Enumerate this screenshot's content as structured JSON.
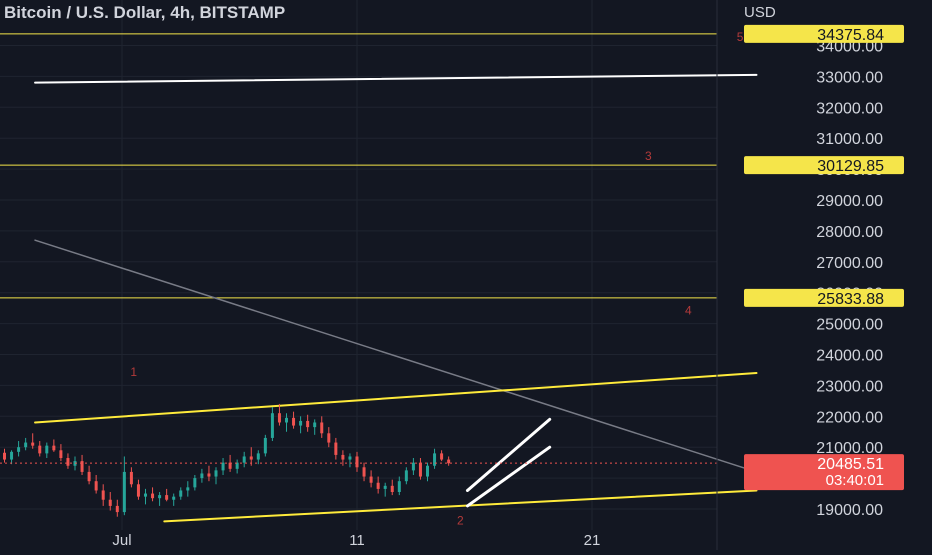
{
  "header": {
    "title": "Bitcoin / U.S. Dollar, 4h, BITSTAMP"
  },
  "axis": {
    "currency": "USD"
  },
  "colors": {
    "background": "#131722",
    "grid": "#1f2430",
    "up": "#26a69a",
    "down": "#ef5350",
    "level": "#f5e54a",
    "channel": "#ffeb3b",
    "white_line": "#ffffff",
    "trend": "#787b86",
    "wave_label": "#b33a3a",
    "axis_text": "#d1d4dc"
  },
  "chart_data": {
    "type": "candlestick",
    "title": "Bitcoin / U.S. Dollar, 4h, BITSTAMP",
    "ylabel": "USD",
    "ylim": [
      18350,
      35000
    ],
    "xlabel": "",
    "x_ticks": [
      "Jul",
      "11",
      "21"
    ],
    "y_ticks": [
      19000,
      20000,
      21000,
      22000,
      23000,
      24000,
      25000,
      26000,
      27000,
      28000,
      29000,
      30000,
      31000,
      32000,
      33000,
      34000
    ],
    "y_tick_labels": [
      "19000.00",
      "20000.00",
      "21000.00",
      "22000.00",
      "23000.00",
      "24000.00",
      "25000.00",
      "26000.00",
      "27000.00",
      "28000.00",
      "29000.00",
      "30000.00",
      "31000.00",
      "32000.00",
      "33000.00",
      "34000.00"
    ],
    "last_price": {
      "value": 20485.51,
      "label": "20485.51",
      "countdown": "03:40:01"
    },
    "horizontal_levels": [
      {
        "value": 34375.84,
        "label": "34375.84"
      },
      {
        "value": 30129.85,
        "label": "30129.85"
      },
      {
        "value": 25833.88,
        "label": "25833.88"
      }
    ],
    "wave_labels": [
      {
        "text": "1",
        "day": 0.5,
        "price": 23300
      },
      {
        "text": "2",
        "day": 14.4,
        "price": 18500
      },
      {
        "text": "3",
        "day": 22.4,
        "price": 30300
      },
      {
        "text": "4",
        "day": 24.1,
        "price": 25300
      },
      {
        "text": "5",
        "day": 26.3,
        "price": 34150
      }
    ],
    "lines": [
      {
        "role": "white-resistance",
        "from": {
          "day": -3.7,
          "price": 32800
        },
        "to": {
          "day": 27,
          "price": 33050
        }
      },
      {
        "role": "descending-trend",
        "from": {
          "day": -3.7,
          "price": 27700
        },
        "to": {
          "day": 27,
          "price": 20200
        }
      },
      {
        "role": "channel-top",
        "from": {
          "day": -3.7,
          "price": 21800
        },
        "to": {
          "day": 27,
          "price": 23400
        }
      },
      {
        "role": "channel-bottom",
        "from": {
          "day": 1.8,
          "price": 18600
        },
        "to": {
          "day": 27,
          "price": 19600
        }
      },
      {
        "role": "rising-channel-upper",
        "from": {
          "day": 14.7,
          "price": 19600
        },
        "to": {
          "day": 18.2,
          "price": 21900
        }
      },
      {
        "role": "rising-channel-lower",
        "from": {
          "day": 14.7,
          "price": 19100
        },
        "to": {
          "day": 18.2,
          "price": 21000
        }
      }
    ],
    "candles": [
      [
        20750,
        21050,
        20600,
        20820
      ],
      [
        20820,
        20950,
        20500,
        20600
      ],
      [
        20600,
        20900,
        20450,
        20850
      ],
      [
        20850,
        21200,
        20700,
        21000
      ],
      [
        21000,
        21300,
        20900,
        21150
      ],
      [
        21150,
        21450,
        20950,
        21050
      ],
      [
        21050,
        21200,
        20700,
        20800
      ],
      [
        20800,
        21150,
        20650,
        21050
      ],
      [
        21050,
        21250,
        20850,
        20900
      ],
      [
        20900,
        21100,
        20550,
        20650
      ],
      [
        20650,
        20800,
        20300,
        20400
      ],
      [
        20400,
        20700,
        20250,
        20550
      ],
      [
        20550,
        20750,
        20100,
        20200
      ],
      [
        20200,
        20400,
        19800,
        19900
      ],
      [
        19900,
        20100,
        19500,
        19600
      ],
      [
        19600,
        19800,
        19100,
        19300
      ],
      [
        19300,
        19550,
        18950,
        19100
      ],
      [
        19100,
        19300,
        18750,
        18900
      ],
      [
        18900,
        20700,
        18800,
        20200
      ],
      [
        20200,
        20350,
        19700,
        19800
      ],
      [
        19800,
        19950,
        19300,
        19400
      ],
      [
        19400,
        19650,
        19150,
        19500
      ],
      [
        19500,
        19700,
        19250,
        19350
      ],
      [
        19350,
        19550,
        19100,
        19450
      ],
      [
        19450,
        19650,
        19250,
        19300
      ],
      [
        19300,
        19500,
        19100,
        19400
      ],
      [
        19400,
        19700,
        19300,
        19600
      ],
      [
        19600,
        19900,
        19400,
        19700
      ],
      [
        19700,
        20100,
        19600,
        20000
      ],
      [
        20000,
        20300,
        19850,
        20150
      ],
      [
        20150,
        20400,
        19900,
        20050
      ],
      [
        20050,
        20350,
        19800,
        20250
      ],
      [
        20250,
        20650,
        20100,
        20500
      ],
      [
        20500,
        20750,
        20200,
        20300
      ],
      [
        20300,
        20600,
        20150,
        20500
      ],
      [
        20500,
        20850,
        20350,
        20700
      ],
      [
        20700,
        21000,
        20400,
        20600
      ],
      [
        20600,
        20900,
        20450,
        20800
      ],
      [
        20800,
        21400,
        20700,
        21300
      ],
      [
        21300,
        22300,
        21200,
        22100
      ],
      [
        22100,
        22400,
        21700,
        21800
      ],
      [
        21800,
        22100,
        21500,
        21950
      ],
      [
        21950,
        22150,
        21600,
        21700
      ],
      [
        21700,
        22000,
        21450,
        21850
      ],
      [
        21850,
        22050,
        21500,
        21650
      ],
      [
        21650,
        21900,
        21400,
        21800
      ],
      [
        21800,
        22000,
        21300,
        21450
      ],
      [
        21450,
        21650,
        21000,
        21150
      ],
      [
        21150,
        21300,
        20600,
        20750
      ],
      [
        20750,
        20900,
        20400,
        20600
      ],
      [
        20600,
        20800,
        20350,
        20700
      ],
      [
        20700,
        20850,
        20200,
        20350
      ],
      [
        20350,
        20500,
        19900,
        20050
      ],
      [
        20050,
        20250,
        19700,
        19850
      ],
      [
        19850,
        20050,
        19500,
        19650
      ],
      [
        19650,
        19850,
        19400,
        19750
      ],
      [
        19750,
        19950,
        19450,
        19550
      ],
      [
        19550,
        20050,
        19450,
        19900
      ],
      [
        19900,
        20350,
        19800,
        20250
      ],
      [
        20250,
        20650,
        20100,
        20500
      ],
      [
        20500,
        20650,
        19950,
        20050
      ],
      [
        20050,
        20500,
        19900,
        20400
      ],
      [
        20400,
        20950,
        20300,
        20800
      ],
      [
        20800,
        20900,
        20550,
        20600
      ],
      [
        20600,
        20700,
        20400,
        20480
      ]
    ]
  }
}
